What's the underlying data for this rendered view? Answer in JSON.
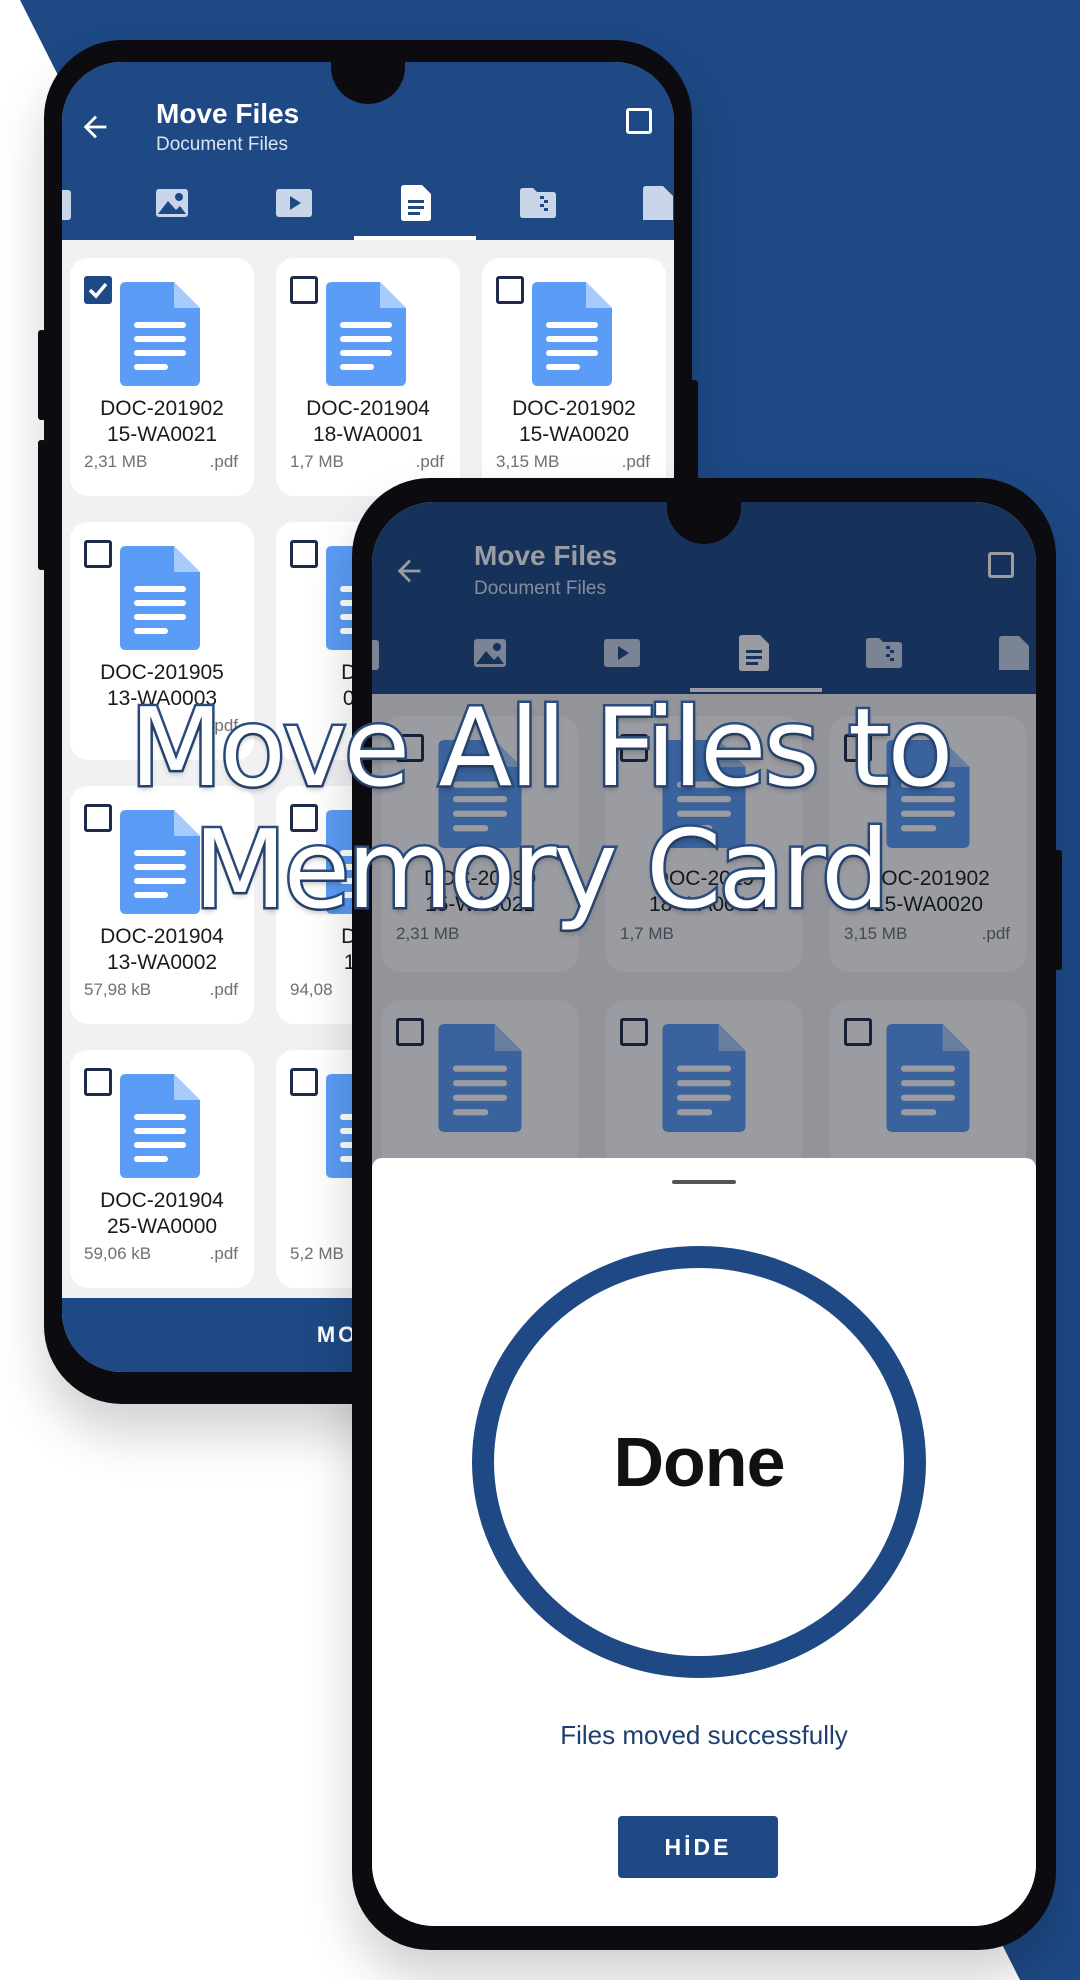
{
  "colors": {
    "brand": "#1e4985",
    "background_shape": "#1e4985",
    "checkbox": "#1e2a4a",
    "doc_icon": "#5b9cf6"
  },
  "back_phone": {
    "appbar": {
      "title": "Move Files",
      "subtitle": "Document Files",
      "back_icon": "arrow-left-icon",
      "select_all_icon": "checkbox-outline-icon"
    },
    "tabs": [
      {
        "icon": "document-partial-icon"
      },
      {
        "icon": "image-icon"
      },
      {
        "icon": "video-icon"
      },
      {
        "icon": "document-icon",
        "active": true
      },
      {
        "icon": "archive-folder-icon"
      },
      {
        "icon": "file-icon"
      }
    ],
    "files": [
      {
        "name_line1": "DOC-201902",
        "name_line2": "15-WA0021",
        "size": "2,31 MB",
        "ext": ".pdf",
        "checked": true
      },
      {
        "name_line1": "DOC-201904",
        "name_line2": "18-WA0001",
        "size": "1,7 MB",
        "ext": ".pdf",
        "checked": false
      },
      {
        "name_line1": "DOC-201902",
        "name_line2": "15-WA0020",
        "size": "3,15 MB",
        "ext": ".pdf",
        "checked": false
      },
      {
        "name_line1": "DOC-201905",
        "name_line2": "13-WA0003",
        "size": "",
        "ext": ".pdf",
        "checked": false
      },
      {
        "name_line1": "DOC-",
        "name_line2": "08-W",
        "size": "",
        "ext": "",
        "checked": false
      },
      {
        "name_line1": "DOC-201904",
        "name_line2": "13-WA0002",
        "size": "57,98 kB",
        "ext": ".pdf",
        "checked": false
      },
      {
        "name_line1": "DOC-",
        "name_line2": "11-W",
        "size": "94,08",
        "ext": "",
        "checked": false
      },
      {
        "name_line1": "DOC-201904",
        "name_line2": "25-WA0000",
        "size": "59,06 kB",
        "ext": ".pdf",
        "checked": false
      },
      {
        "name_line1": "",
        "name_line2": "E",
        "size": "5,2 MB",
        "ext": "",
        "checked": false
      }
    ],
    "move_button": "MOVE F"
  },
  "front_phone": {
    "appbar": {
      "title": "Move Files",
      "subtitle": "Document Files"
    },
    "files": [
      {
        "name_line1": "DOC-20190",
        "name_line2": "15-WA0021",
        "size": "2,31 MB"
      },
      {
        "name_line1": "DOC-2019",
        "name_line2": "18-WA0001",
        "size": "1,7 MB"
      },
      {
        "name_line1": "DOC-201902",
        "name_line2": "15-WA0020",
        "size": "3,15 MB",
        "ext": ".pdf"
      }
    ],
    "sheet": {
      "status": "Done",
      "message": "Files moved successfully",
      "hide_button": "HİDE"
    }
  },
  "headline": {
    "line1": "Move All Files to",
    "line2": "Memory Card"
  }
}
